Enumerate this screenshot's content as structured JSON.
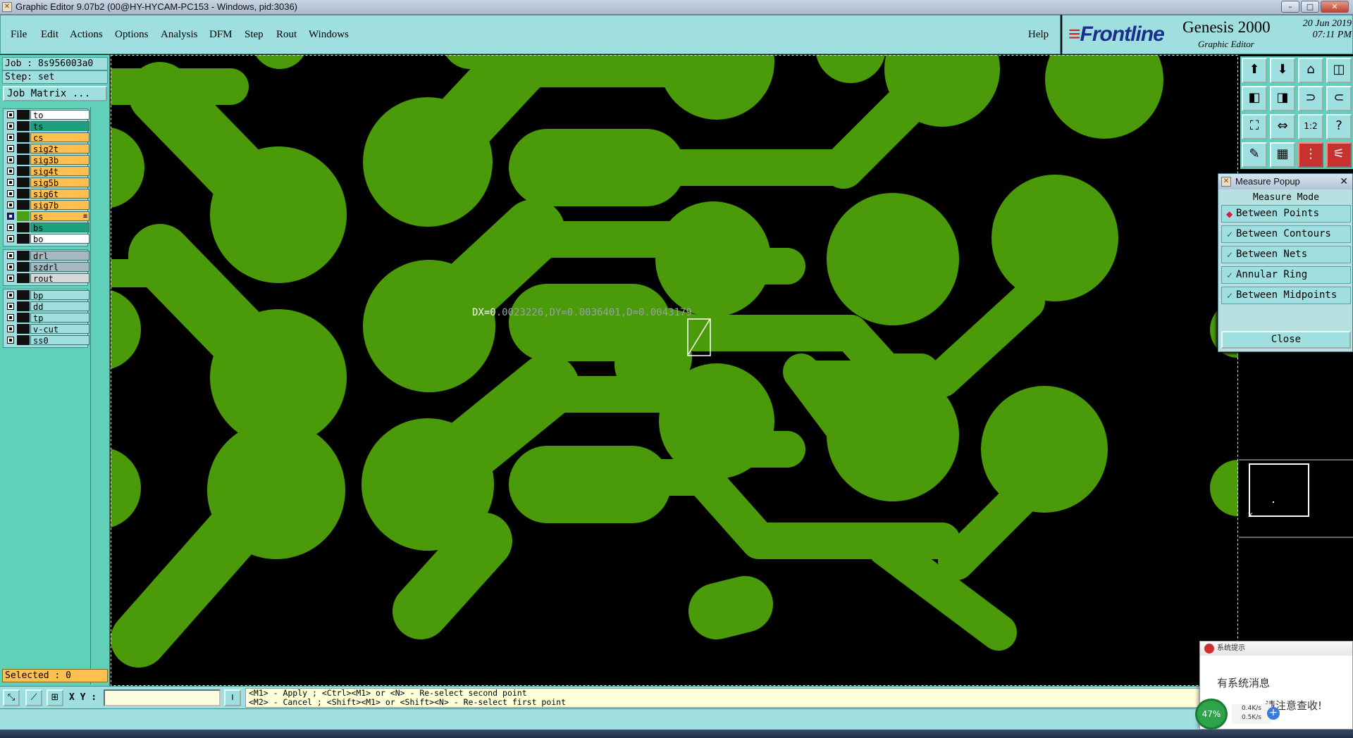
{
  "window": {
    "title": "Graphic Editor 9.07b2 (00@HY-HYCAM-PC153 - Windows, pid:3036)",
    "controls": [
      "–",
      "□",
      "✕"
    ]
  },
  "menu": {
    "items": [
      "File",
      "Edit",
      "Actions",
      "Options",
      "Analysis",
      "DFM",
      "Step",
      "Rout",
      "Windows"
    ],
    "help": "Help"
  },
  "brand": {
    "logo": "Frontline",
    "product": "Genesis 2000",
    "subtitle": "Graphic Editor",
    "date": "20 Jun 2019",
    "time": "07:11 PM"
  },
  "job": {
    "job_label": "Job : 8s956003a0",
    "step_label": "Step: set",
    "matrix_button": "Job Matrix ..."
  },
  "layers": {
    "group1": [
      {
        "name": "to",
        "color": "#ffffff",
        "selected": false
      },
      {
        "name": "ts",
        "color": "#1ca080",
        "selected": false
      },
      {
        "name": "cs",
        "color": "#ffc050",
        "selected": false
      },
      {
        "name": "sig2t",
        "color": "#ffc050",
        "selected": false
      },
      {
        "name": "sig3b",
        "color": "#ffc050",
        "selected": false
      },
      {
        "name": "sig4t",
        "color": "#ffc050",
        "selected": false
      },
      {
        "name": "sig5b",
        "color": "#ffc050",
        "selected": false
      },
      {
        "name": "sig6t",
        "color": "#ffc050",
        "selected": false
      },
      {
        "name": "sig7b",
        "color": "#ffc050",
        "selected": false
      },
      {
        "name": "ss",
        "color": "#ffc050",
        "selected": true,
        "mark": "≡"
      },
      {
        "name": "bs",
        "color": "#1ca080",
        "selected": false
      },
      {
        "name": "bo",
        "color": "#ffffff",
        "selected": false
      }
    ],
    "group2": [
      {
        "name": "drl",
        "color": "#a8b8c0",
        "selected": false
      },
      {
        "name": "szdrl",
        "color": "#a8b8c0",
        "selected": false
      },
      {
        "name": "rout",
        "color": "#d8d8d8",
        "selected": false
      }
    ],
    "group3": [
      {
        "name": "bp",
        "color": "#9fdfe0",
        "selected": false
      },
      {
        "name": "dd",
        "color": "#9fdfe0",
        "selected": false
      },
      {
        "name": "tp",
        "color": "#9fdfe0",
        "selected": false
      },
      {
        "name": "v-cut",
        "color": "#9fdfe0",
        "selected": false
      },
      {
        "name": "ss0",
        "color": "#9fdfe0",
        "selected": false
      }
    ],
    "selected_label": "Selected : 0"
  },
  "canvas": {
    "copper_color": "#4a9a0a",
    "readout_prefix": "DX=0",
    "readout_rest": ".0023226,DY=0.0036401,D=0.0043179"
  },
  "toolbox": {
    "icons": [
      "snapshot-icon",
      "load-icon",
      "home-icon",
      "split-view-icon",
      "pan-left-icon",
      "pan-right-icon",
      "mirror-icon",
      "flip-icon",
      "fit-screen-icon",
      "fit-width-icon",
      "one-to-two-icon",
      "help-icon",
      "pen-icon",
      "grid-icon",
      "layers-red-icon",
      "settings-red-icon"
    ],
    "glyphs": [
      "⬆",
      "⬇",
      "⌂",
      "◫",
      "◧",
      "◨",
      "⊃",
      "⊂",
      "⛶",
      "⇔",
      "1:2",
      "?",
      "✎",
      "▦",
      "⋮",
      "⚟"
    ]
  },
  "measure_popup": {
    "title": "Measure Popup",
    "mode_header": "Measure Mode",
    "options": [
      {
        "label": "Between Points",
        "selected": true
      },
      {
        "label": "Between Contours",
        "selected": false
      },
      {
        "label": "Between Nets",
        "selected": false
      },
      {
        "label": "Annular Ring",
        "selected": false
      },
      {
        "label": "Between Midpoints",
        "selected": false
      }
    ],
    "close_label": "Close"
  },
  "bottom": {
    "xy_label": "X Y :",
    "xy_value": "",
    "hint_line1": "<M1> - Apply  ; <Ctrl><M1> or <N> - Re-select second point",
    "hint_line2": "<M2> - Cancel ; <Shift><M1> or <Shift><N> - Re-select first point"
  },
  "notification": {
    "header": "系统提示",
    "message": "有系统消息",
    "message2": "请注意查收!"
  },
  "network": {
    "percent": "47%",
    "up": "0.4K/s",
    "down": "0.5K/s"
  }
}
